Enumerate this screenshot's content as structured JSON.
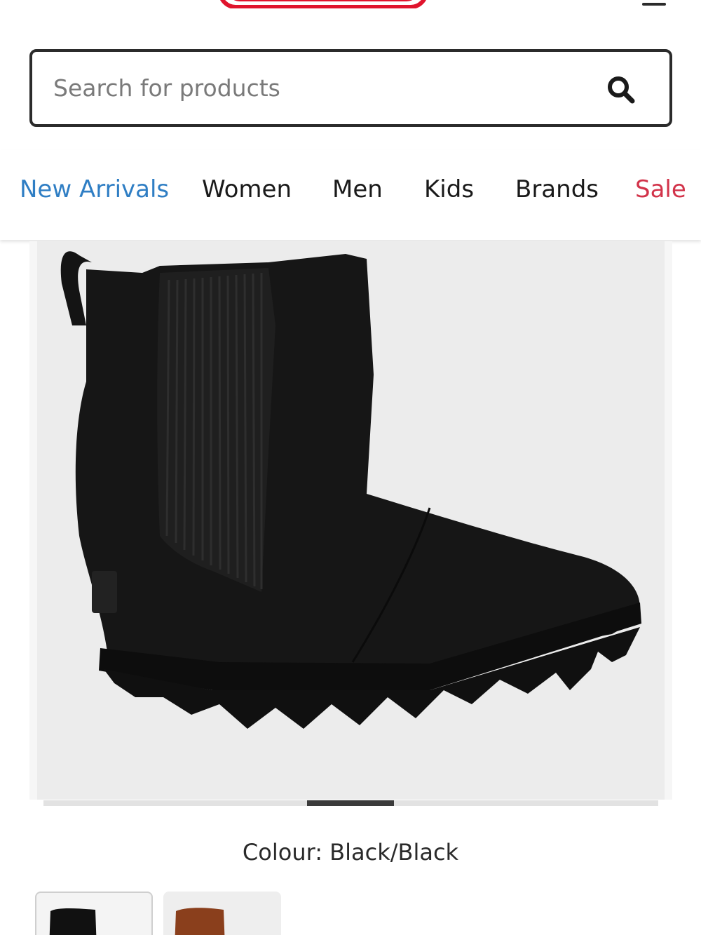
{
  "header": {
    "logo_icon": "brand-logo",
    "menu_icon": "hamburger-menu-icon"
  },
  "search": {
    "placeholder": "Search for products",
    "icon": "search-icon"
  },
  "nav": {
    "items": [
      {
        "label": "New Arrivals",
        "color": "#2f7ec4"
      },
      {
        "label": "Women"
      },
      {
        "label": "Men"
      },
      {
        "label": "Kids"
      },
      {
        "label": "Brands"
      },
      {
        "label": "Sale",
        "color": "#d2334a"
      }
    ]
  },
  "product": {
    "image_icon": "black-wedge-chelsea-boot",
    "gallery_progress": {
      "current": 4,
      "total": 7
    },
    "colour_label": "Colour:",
    "colour_value": "Black/Black",
    "swatches": [
      {
        "color": "#111111",
        "selected": true
      },
      {
        "color": "#8a3f1c",
        "selected": false
      }
    ]
  }
}
